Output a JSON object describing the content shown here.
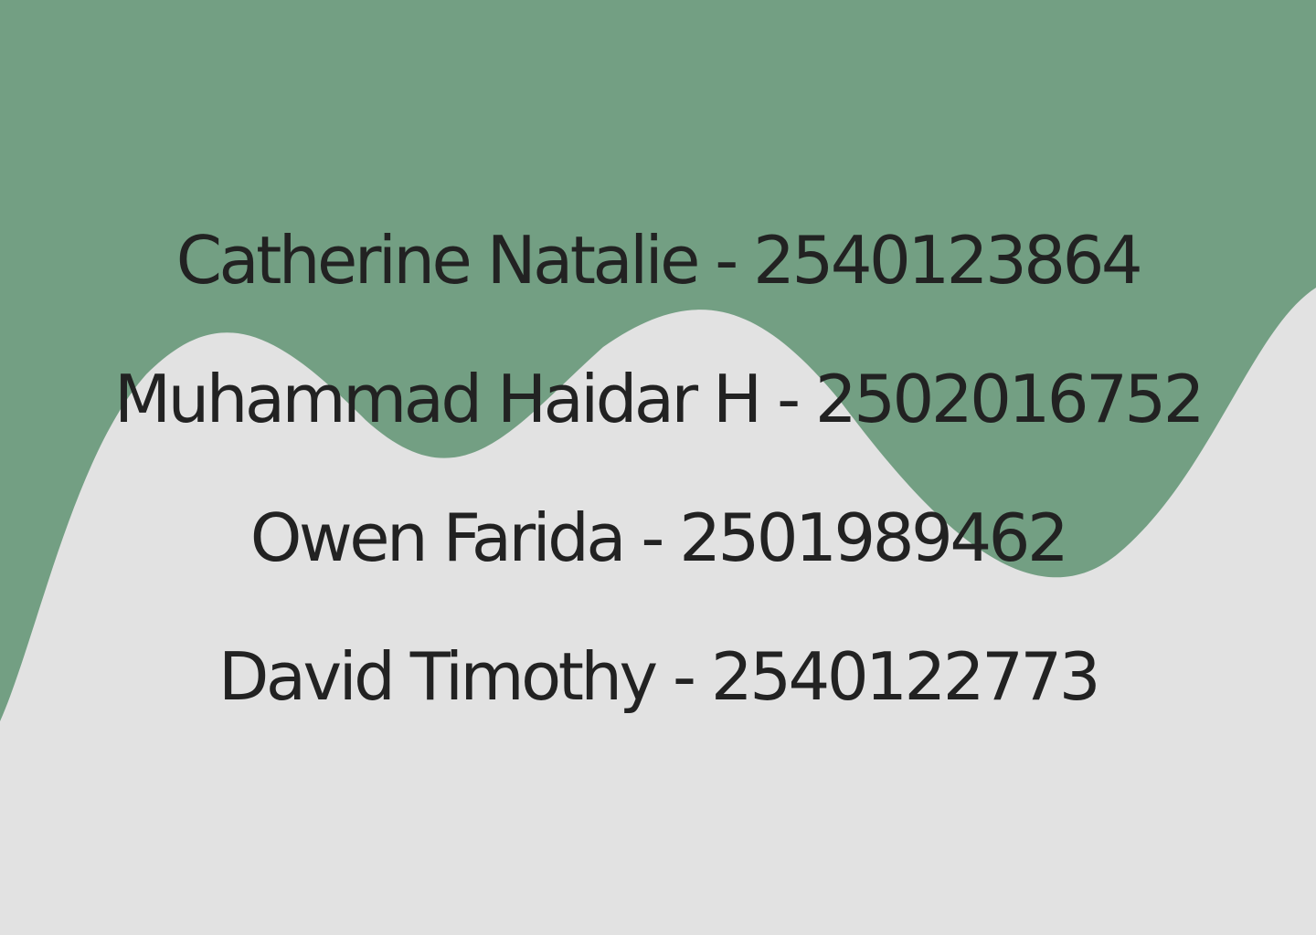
{
  "colors": {
    "background": "#e2e2e2",
    "wave": "#739f83",
    "text": "#222222"
  },
  "entries": [
    {
      "text": "Catherine Natalie - 2540123864"
    },
    {
      "text": "Muhammad Haidar H - 2502016752"
    },
    {
      "text": "Owen Farida - 2501989462"
    },
    {
      "text": "David Timothy - 2540122773"
    }
  ]
}
